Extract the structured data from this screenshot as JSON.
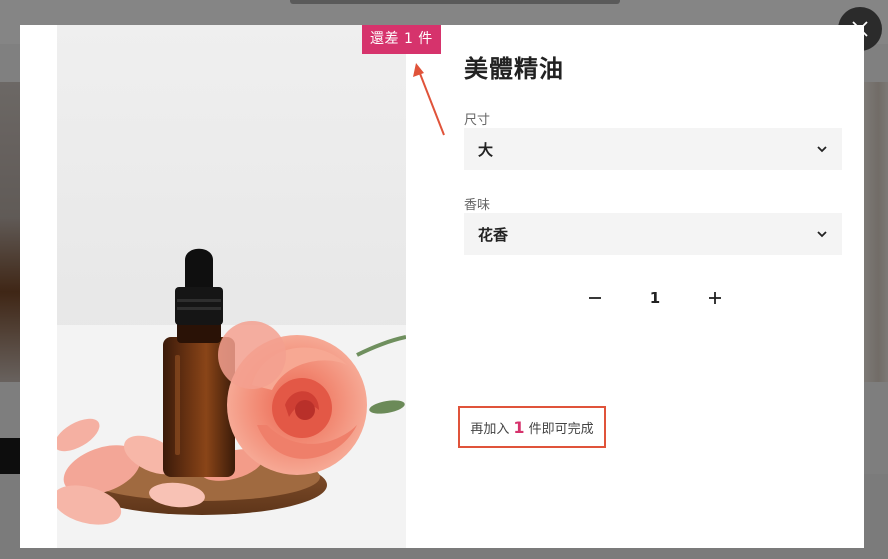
{
  "product": {
    "title": "美體精油",
    "badge": "還差 1 件",
    "image_icon": "essential-oil-bottle-with-roses"
  },
  "options": {
    "size": {
      "label": "尺寸",
      "value": "大"
    },
    "scent": {
      "label": "香味",
      "value": "花香"
    }
  },
  "quantity": {
    "minus_icon": "minus-icon",
    "value": "1",
    "plus_icon": "plus-icon"
  },
  "progress": {
    "prefix": "再加入",
    "count": "1",
    "suffix": "件即可完成"
  },
  "colors": {
    "badge": "#d6336c",
    "annotation": "#e0533a",
    "close_button": "#2b2b2b"
  }
}
